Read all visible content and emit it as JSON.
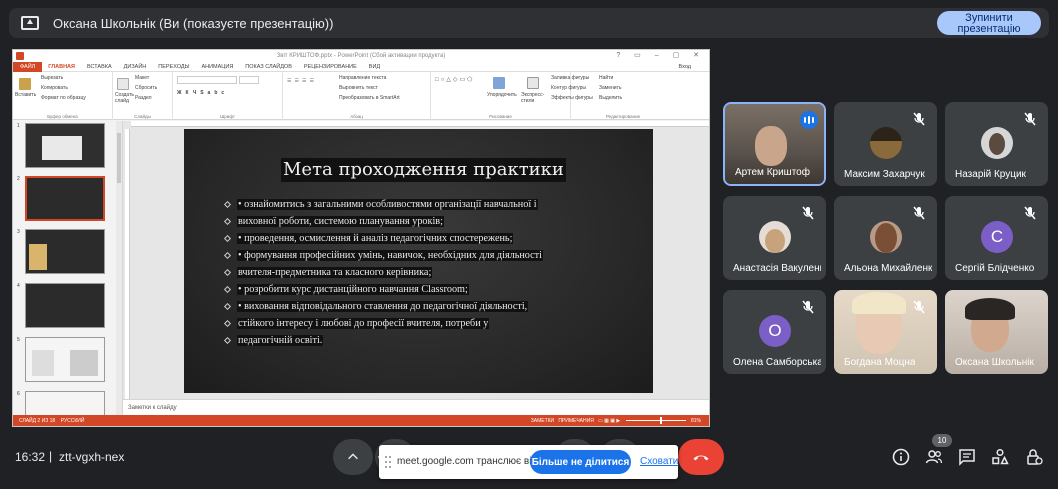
{
  "top_bar": {
    "presenter_text": "Оксана Школьнік (Ви (показуєте презентацію))",
    "stop_button_line1": "Зупинити",
    "stop_button_line2": "презентацію"
  },
  "powerpoint": {
    "window_title": "Звіт КРИШТОФ.pptx - PowerPoint (Сбой активации продукта)",
    "tabs": [
      "ФАЙЛ",
      "ГЛАВНАЯ",
      "ВСТАВКА",
      "ДИЗАЙН",
      "ПЕРЕХОДЫ",
      "АНИМАЦИЯ",
      "ПОКАЗ СЛАЙДОВ",
      "РЕЦЕНЗИРОВАНИЕ",
      "ВИД"
    ],
    "login": "Вход",
    "ribbon": {
      "paste": "Вставить",
      "cut": "Вырезать",
      "copy": "Копировать",
      "format_painter": "Формат по образцу",
      "clipboard_group": "Буфер обмена",
      "new_slide": "Создать слайд",
      "layout": "Макет",
      "reset": "Сбросить",
      "section": "Раздел",
      "slides_group": "Слайды",
      "font_group": "Шрифт",
      "paragraph_group": "Абзац",
      "text_direction": "Направление текста",
      "align_text": "Выровнять текст",
      "smartart": "Преобразовать в SmartArt",
      "drawing_group": "Рисование",
      "arrange": "Упорядочить",
      "quick_styles": "Экспресс-стили",
      "shape_fill": "Заливка фигуры",
      "shape_outline": "Контур фигуры",
      "shape_effects": "Эффекты фигуры",
      "find": "Найти",
      "replace": "Заменить",
      "select": "Выделить",
      "editing_group": "Редактирование"
    },
    "slide_numbers": [
      "1",
      "2",
      "3",
      "4",
      "5",
      "6"
    ],
    "slide": {
      "title": "Мета проходження практики",
      "bullets": [
        "• ознайомитись з загальними особливостями організації навчальної і",
        "виховної роботи, системою планування уроків;",
        "• проведення, осмислення й аналіз педагогічних спостережень;",
        "• формування професійних умінь, навичок, необхідних для діяльності",
        "вчителя-предметника та класного керівника;",
        "• розробити курс дистанційного навчання Classroom;",
        "• виховання відповідального ставлення до педагогічної діяльності,",
        "стійкого інтересу і любові до професії вчителя, потреби у",
        "педагогічній освіті."
      ]
    },
    "notes_placeholder": "Заметки к слайду",
    "status": {
      "slide_info": "СЛАЙД 2 ИЗ 18",
      "language": "РУССКИЙ",
      "notes": "ЗАМЕТКИ",
      "comments": "ПРИМЕЧАНИЯ",
      "zoom": "81%"
    }
  },
  "participants": [
    {
      "name": "Артем Криштоф",
      "speaking": true,
      "muted": false
    },
    {
      "name": "Максим Захарчук",
      "muted": true
    },
    {
      "name": "Назарій Круцик",
      "muted": true
    },
    {
      "name": "Анастасія Вакуленко",
      "muted": true
    },
    {
      "name": "Альона Михайленко",
      "muted": true
    },
    {
      "name": "Сергій Блідченко",
      "muted": true,
      "letter": "С",
      "color": "#7b5fc6"
    },
    {
      "name": "Олена Самборська",
      "muted": true,
      "letter": "О",
      "color": "#7b5fc6"
    },
    {
      "name": "Богдана Моцна",
      "muted": true
    },
    {
      "name": "Оксана Школьнік",
      "muted": false
    }
  ],
  "bottom": {
    "time": "16:32",
    "separator": "|",
    "meeting_code": "ztt-vgxh-nex",
    "people_count": "10"
  },
  "share_popup": {
    "message": "meet.google.com транслює вікно.",
    "stop_sharing": "Більше не ділитися",
    "cancel": "Сховати"
  },
  "colors": {
    "accent_blue": "#1a73e8",
    "hangup_red": "#ea4335",
    "ppt_orange": "#d24726",
    "tile_bg": "#3c4043"
  }
}
